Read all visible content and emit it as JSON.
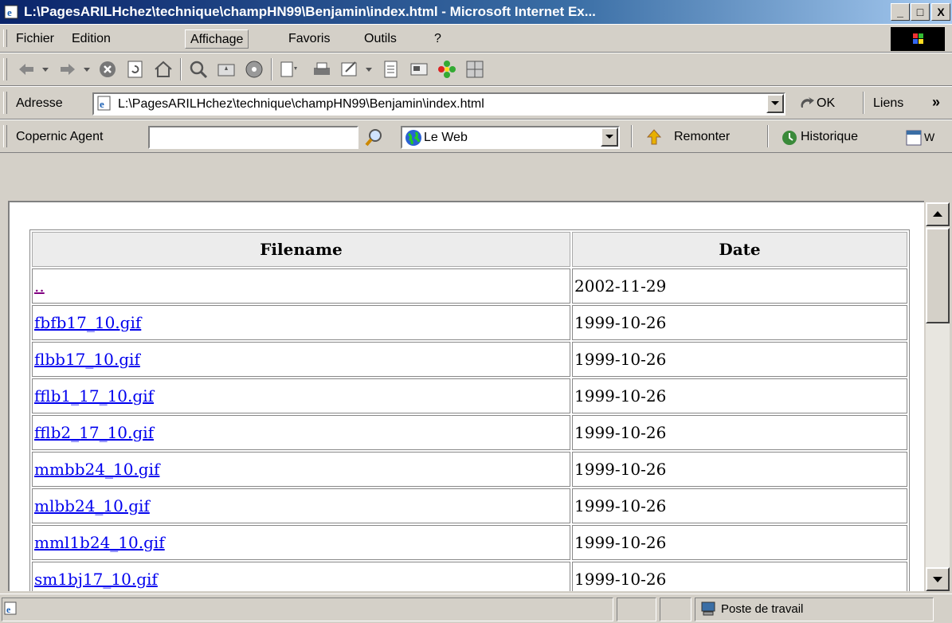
{
  "window": {
    "title": "L:\\PagesARILHchez\\technique\\champHN99\\Benjamin\\index.html - Microsoft Internet Ex...",
    "minimize": "_",
    "maximize": "□",
    "close": "X"
  },
  "menu": [
    "Fichier",
    "Edition",
    "Affichage",
    "Favoris",
    "Outils",
    "?"
  ],
  "address_bar": {
    "label": "Adresse",
    "value": "L:\\PagesARILHchez\\technique\\champHN99\\Benjamin\\index.html",
    "go_label": "OK",
    "links_label": "Liens",
    "more": "»"
  },
  "copernic": {
    "label": "Copernic Agent",
    "search_value": "",
    "scope": "Le Web",
    "up_label": "Remonter",
    "history_label": "Historique",
    "truncated": "W"
  },
  "table": {
    "headers": [
      "Filename",
      "Date"
    ],
    "rows": [
      {
        "name": "..",
        "date": "2002-11-29"
      },
      {
        "name": "fbfb17_10.gif",
        "date": "1999-10-26"
      },
      {
        "name": "flbb17_10.gif",
        "date": "1999-10-26"
      },
      {
        "name": "fflb1_17_10.gif",
        "date": "1999-10-26"
      },
      {
        "name": "fflb2_17_10.gif",
        "date": "1999-10-26"
      },
      {
        "name": "mmbb24_10.gif",
        "date": "1999-10-26"
      },
      {
        "name": "mlbb24_10.gif",
        "date": "1999-10-26"
      },
      {
        "name": "mml1b24_10.gif",
        "date": "1999-10-26"
      },
      {
        "name": "sm1bj17_10.gif",
        "date": "1999-10-26"
      }
    ]
  },
  "status": {
    "zone": "Poste de travail"
  },
  "colors": {
    "chrome": "#d4d0c8",
    "title_start": "#0a246a",
    "link": "#0000ee",
    "visited": "#800080"
  }
}
